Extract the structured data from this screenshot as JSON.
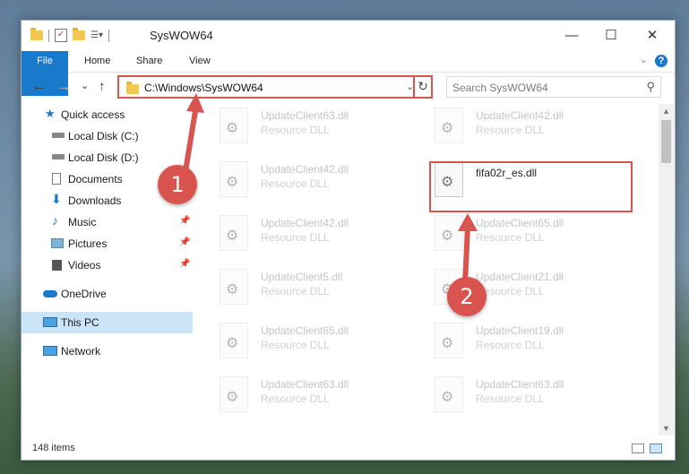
{
  "window": {
    "title": "SysWOW64"
  },
  "controls": {
    "minimize": "—",
    "maximize": "☐",
    "close": "✕"
  },
  "ribbon": {
    "tabs": [
      "File",
      "Home",
      "Share",
      "View"
    ],
    "chevron": "⌄",
    "help": "?"
  },
  "nav": {
    "back": "←",
    "forward": "→",
    "recent": "⌄",
    "up": "↑",
    "refresh": "↻",
    "dropdown": "⌄"
  },
  "address": {
    "path": "C:\\Windows\\SysWOW64"
  },
  "search": {
    "placeholder": "Search SysWOW64"
  },
  "sidebar": {
    "items": [
      {
        "label": "Quick access",
        "icon": "star-icon"
      },
      {
        "label": "Local Disk (C:)",
        "icon": "drive-icon"
      },
      {
        "label": "Local Disk (D:)",
        "icon": "drive-icon"
      },
      {
        "label": "Documents",
        "icon": "documents-icon",
        "pinned": true
      },
      {
        "label": "Downloads",
        "icon": "downloads-icon",
        "pinned": true
      },
      {
        "label": "Music",
        "icon": "music-icon",
        "pinned": true
      },
      {
        "label": "Pictures",
        "icon": "pictures-icon",
        "pinned": true
      },
      {
        "label": "Videos",
        "icon": "videos-icon",
        "pinned": true
      },
      {
        "label": "OneDrive",
        "icon": "onedrive-icon"
      },
      {
        "label": "This PC",
        "icon": "pc-icon",
        "selected": true
      },
      {
        "label": "Network",
        "icon": "network-icon"
      }
    ],
    "pin_glyph": "📌"
  },
  "files": [
    {
      "name": "UpdateClient63.dll",
      "type": "Resource DLL"
    },
    {
      "name": "UpdateClient42.dll",
      "type": "Resource DLL"
    },
    {
      "name": "UpdateClient42.dll",
      "type": "Resource DLL"
    },
    {
      "name": "fifa02r_es.dll",
      "type": "",
      "highlighted": true
    },
    {
      "name": "UpdateClient42.dll",
      "type": "Resource DLL"
    },
    {
      "name": "UpdateClient65.dll",
      "type": "Resource DLL"
    },
    {
      "name": "UpdateClient5.dll",
      "type": "Resource DLL"
    },
    {
      "name": "UpdateClient21.dll",
      "type": "Resource DLL"
    },
    {
      "name": "UpdateClient65.dll",
      "type": "Resource DLL"
    },
    {
      "name": "UpdateClient19.dll",
      "type": "Resource DLL"
    },
    {
      "name": "UpdateClient63.dll",
      "type": "Resource DLL"
    },
    {
      "name": "UpdateClient63.dll",
      "type": "Resource DLL"
    }
  ],
  "status": {
    "count": "148 items"
  },
  "annotations": {
    "step1": "1",
    "step2": "2"
  },
  "colors": {
    "accent": "#1979ca",
    "annotation": "#d9534f",
    "selected": "#cce4f7"
  }
}
